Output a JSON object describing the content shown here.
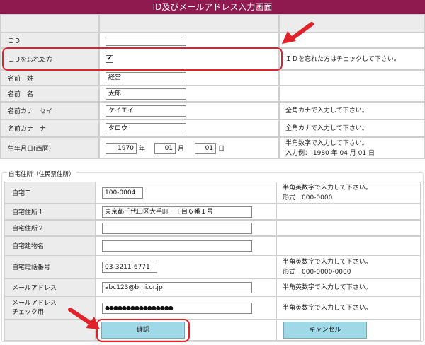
{
  "title": "ID及びメールアドレス入力画面",
  "top_form": {
    "id_label": "ＩＤ",
    "forgot_id_label": "ＩＤを忘れた方",
    "forgot_id_checked": true,
    "forgot_id_note": "ＩＤを忘れた方はチェックして下さい。",
    "last_name_label": "名前　姓",
    "last_name_value": "経営",
    "first_name_label": "名前　名",
    "first_name_value": "太郎",
    "kana_last_label": "名前カナ　セイ",
    "kana_last_value": "ケイエイ",
    "kana_last_note": "全角カナで入力して下さい。",
    "kana_first_label": "名前カナ　ナ",
    "kana_first_value": "タロウ",
    "kana_first_note": "全角カナで入力して下さい。",
    "birth_label": "生年月日(西暦)",
    "birth_year": "1970",
    "birth_year_unit": "年",
    "birth_month": "01",
    "birth_month_unit": "月",
    "birth_day": "01",
    "birth_day_unit": "日",
    "birth_note_1": "半角数字で入力して下さい。",
    "birth_note_2": "入力例：  1980 年 04 月 01 日"
  },
  "address": {
    "legend": "自宅住所（住民票住所）",
    "postal_label": "自宅〒",
    "postal_value": "100-0004",
    "postal_note_1": "半角英数字で入力して下さい。",
    "postal_note_2": "形式　000-0000",
    "addr1_label": "自宅住所１",
    "addr1_value": "東京都千代田区大手町一丁目６番１号",
    "addr2_label": "自宅住所２",
    "addr2_value": "",
    "building_label": "自宅建物名",
    "building_value": "",
    "phone_label": "自宅電話番号",
    "phone_value": "03-3211-6771",
    "phone_note_1": "半角英数字で入力して下さい。",
    "phone_note_2": "形式　000-0000-0000",
    "email_label": "メールアドレス",
    "email_value": "abc123@bmi.or.jp",
    "email_note": "半角英数字で入力して下さい。",
    "email_confirm_label_1": "メールアドレス",
    "email_confirm_label_2": "チェック用",
    "email_confirm_value": "●●●●●●●●●●●●●●●●",
    "email_confirm_note": "半角英数字で入力して下さい。"
  },
  "buttons": {
    "confirm": "確認",
    "cancel": "キャンセル"
  },
  "colors": {
    "title_bar": "#8e1a4f",
    "label_bg": "#ececec",
    "button_bg": "#9fd8e6",
    "highlight": "#e0222a"
  }
}
